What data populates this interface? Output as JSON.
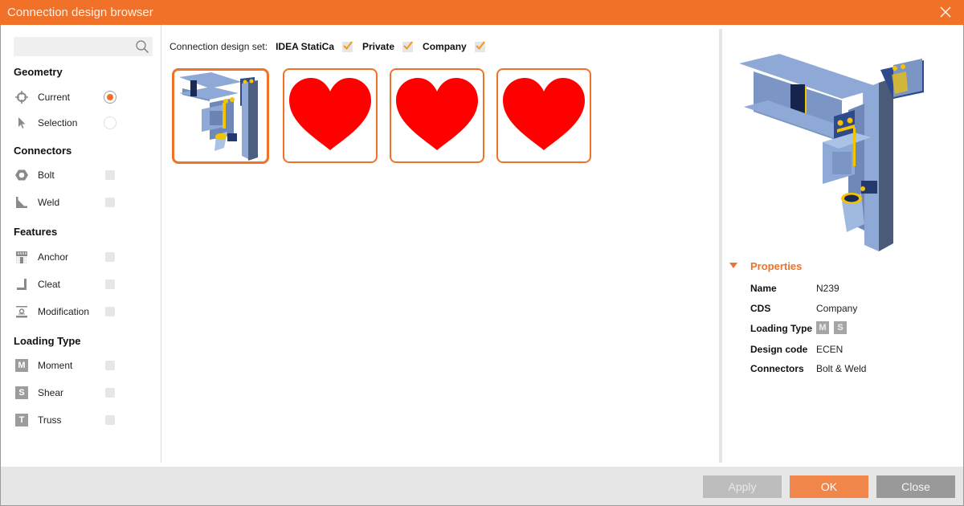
{
  "window": {
    "title": "Connection design browser",
    "close_icon": "close-icon"
  },
  "sidebar": {
    "search": {
      "placeholder": "",
      "value": "",
      "icon": "search-icon"
    },
    "sections": [
      {
        "title": "Geometry",
        "items": [
          {
            "label": "Current",
            "icon": "crosshair-icon",
            "control": "radio",
            "checked": true
          },
          {
            "label": "Selection",
            "icon": "cursor-arrow-icon",
            "control": "radio",
            "checked": false
          }
        ]
      },
      {
        "title": "Connectors",
        "items": [
          {
            "label": "Bolt",
            "icon": "bolt-hex-icon",
            "control": "checkbox",
            "checked": false
          },
          {
            "label": "Weld",
            "icon": "weld-icon",
            "control": "checkbox",
            "checked": false
          }
        ]
      },
      {
        "title": "Features",
        "items": [
          {
            "label": "Anchor",
            "icon": "anchor-icon",
            "control": "checkbox",
            "checked": false
          },
          {
            "label": "Cleat",
            "icon": "cleat-icon",
            "control": "checkbox",
            "checked": false
          },
          {
            "label": "Modification",
            "icon": "modification-icon",
            "control": "checkbox",
            "checked": false
          }
        ]
      },
      {
        "title": "Loading Type",
        "items": [
          {
            "label": "Moment",
            "icon": "M",
            "control": "checkbox",
            "checked": false
          },
          {
            "label": "Shear",
            "icon": "S",
            "control": "checkbox",
            "checked": false
          },
          {
            "label": "Truss",
            "icon": "T",
            "control": "checkbox",
            "checked": false
          }
        ]
      }
    ]
  },
  "main": {
    "cds_label": "Connection design set:",
    "cds_options": [
      {
        "label": "IDEA StatiCa",
        "checked": true
      },
      {
        "label": "Private",
        "checked": true
      },
      {
        "label": "Company",
        "checked": true
      }
    ],
    "thumbnails": [
      {
        "kind": "connection-model",
        "selected": true
      },
      {
        "kind": "heart",
        "selected": false
      },
      {
        "kind": "heart",
        "selected": false
      },
      {
        "kind": "heart",
        "selected": false
      }
    ]
  },
  "properties": {
    "title": "Properties",
    "rows": [
      {
        "key": "Name",
        "value": "N239"
      },
      {
        "key": "CDS",
        "value": "Company"
      },
      {
        "key": "Loading Type",
        "badges": [
          "M",
          "S"
        ]
      },
      {
        "key": "Design code",
        "value": "ECEN"
      },
      {
        "key": "Connectors",
        "value": "Bolt & Weld"
      }
    ]
  },
  "footer": {
    "apply": "Apply",
    "ok": "OK",
    "close": "Close"
  },
  "colors": {
    "accent": "#f07127",
    "heart": "#ff0000",
    "steel": "#7f9fcf",
    "weld": "#f5c400"
  }
}
